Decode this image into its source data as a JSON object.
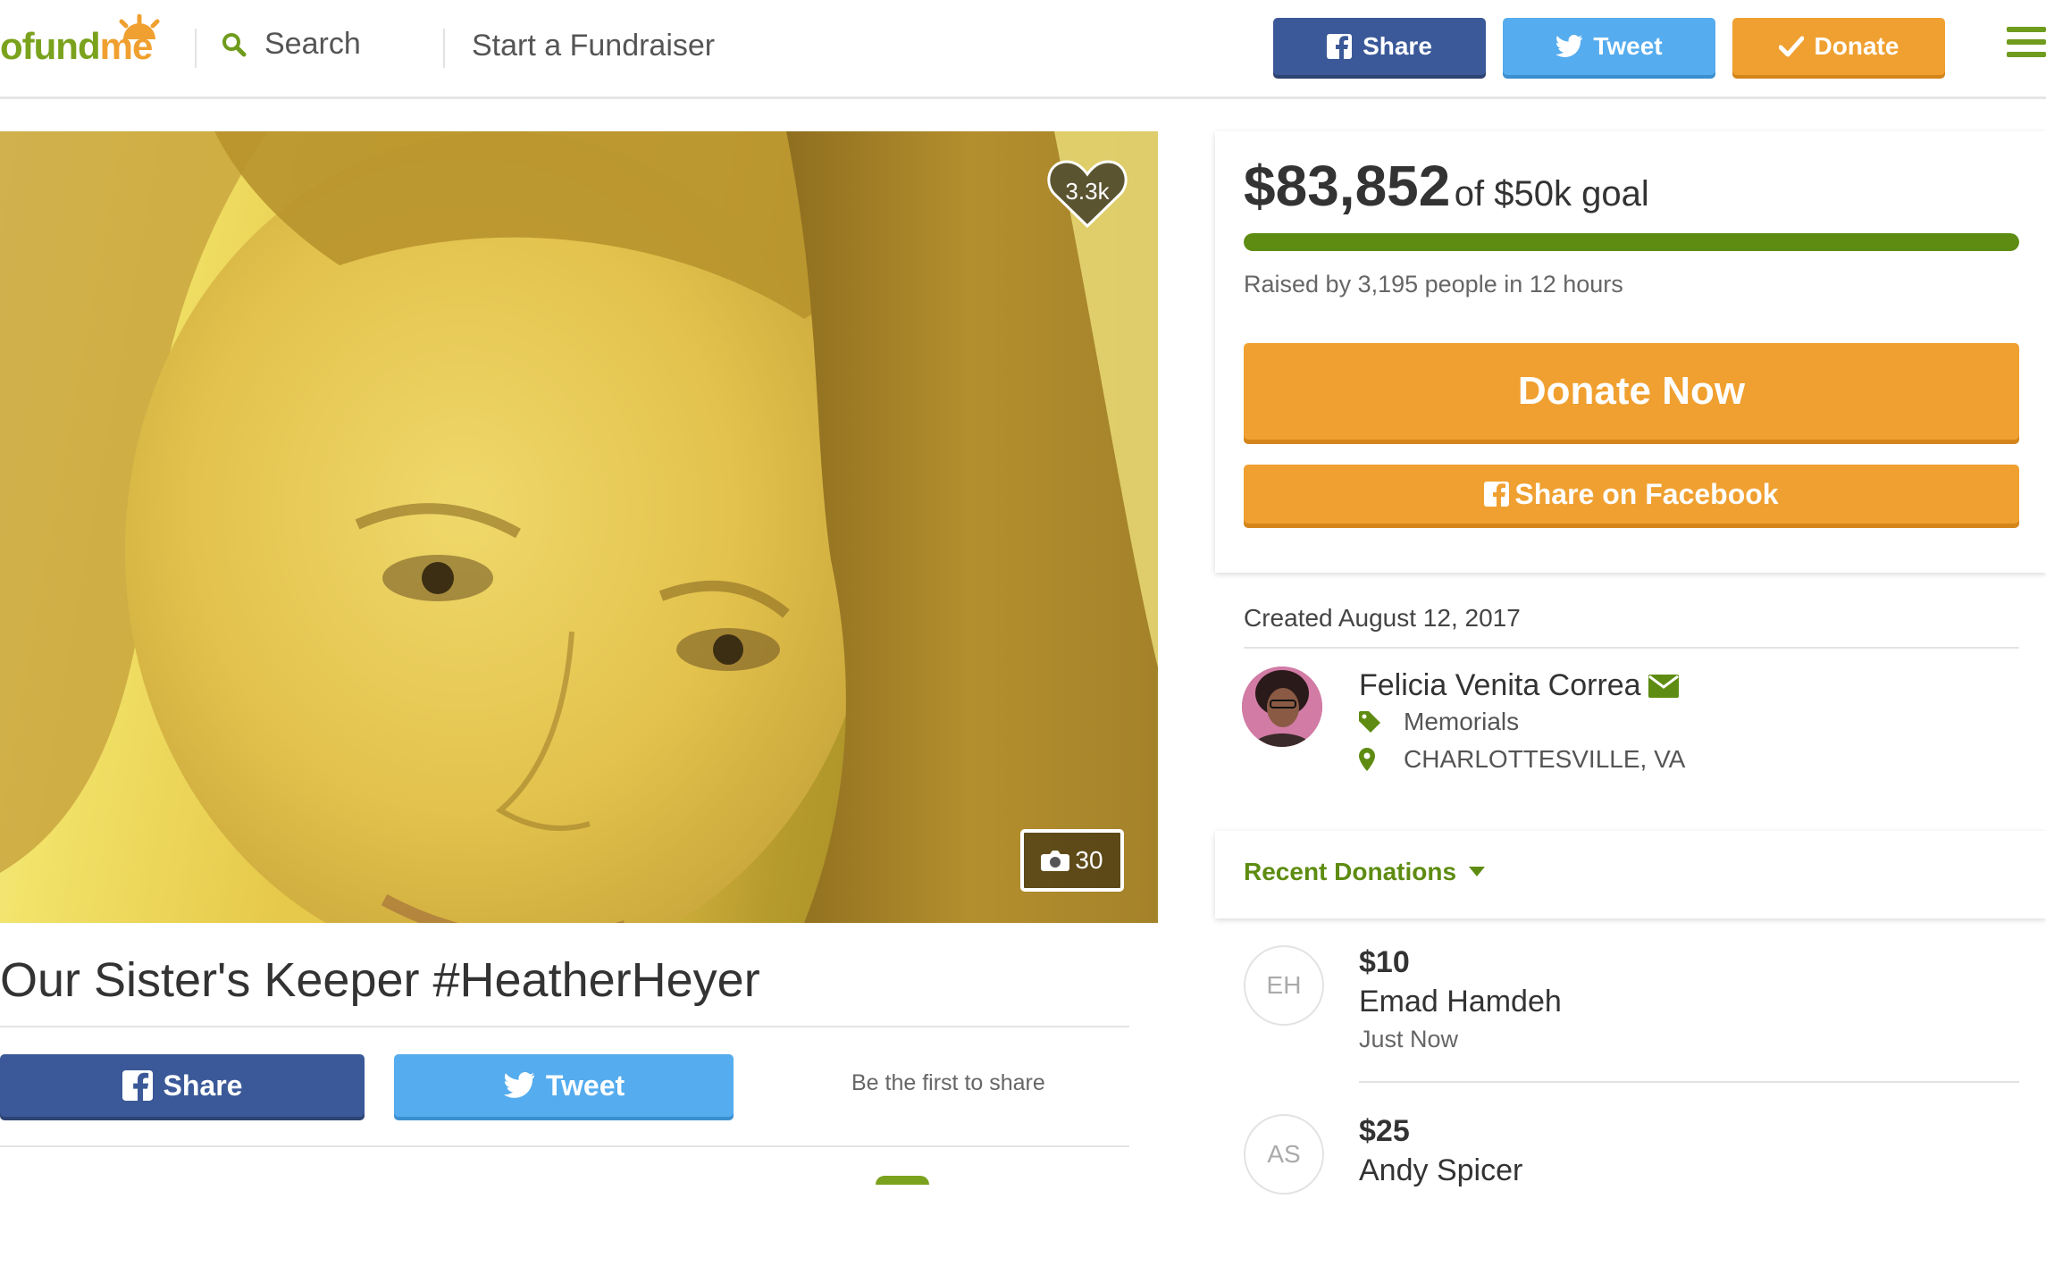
{
  "header": {
    "logo_left": "o",
    "logo_fund": "fund",
    "logo_me": "me",
    "search_label": "Search",
    "start_fundraiser": "Start a Fundraiser",
    "share_label": "Share",
    "tweet_label": "Tweet",
    "donate_label": "Donate",
    "colors": {
      "facebook": "#3b5998",
      "twitter": "#55acee",
      "donate": "#f0a030",
      "brand_green": "#7aa21d"
    }
  },
  "campaign": {
    "hearts": "3.3k",
    "photo_count": "30",
    "title": "Our Sister's Keeper #HeatherHeyer",
    "share_label": "Share",
    "tweet_label": "Tweet",
    "first_to_share": "Be the first to share"
  },
  "goal": {
    "raised": "$83,852",
    "goal_text": "of $50k goal",
    "progress_fraction": 1.0,
    "raised_by": "Raised by 3,195 people in 12 hours",
    "donate_now": "Donate Now",
    "share_facebook": "Share on Facebook"
  },
  "organizer": {
    "created": "Created August 12, 2017",
    "name": "Felicia Venita Correa",
    "category": "Memorials",
    "location": "CHARLOTTESVILLE, VA"
  },
  "donations": {
    "label": "Recent Donations",
    "items": [
      {
        "initials": "EH",
        "amount": "$10",
        "name": "Emad Hamdeh",
        "when": "Just Now"
      },
      {
        "initials": "AS",
        "amount": "$25",
        "name": "Andy Spicer",
        "when": ""
      }
    ]
  }
}
